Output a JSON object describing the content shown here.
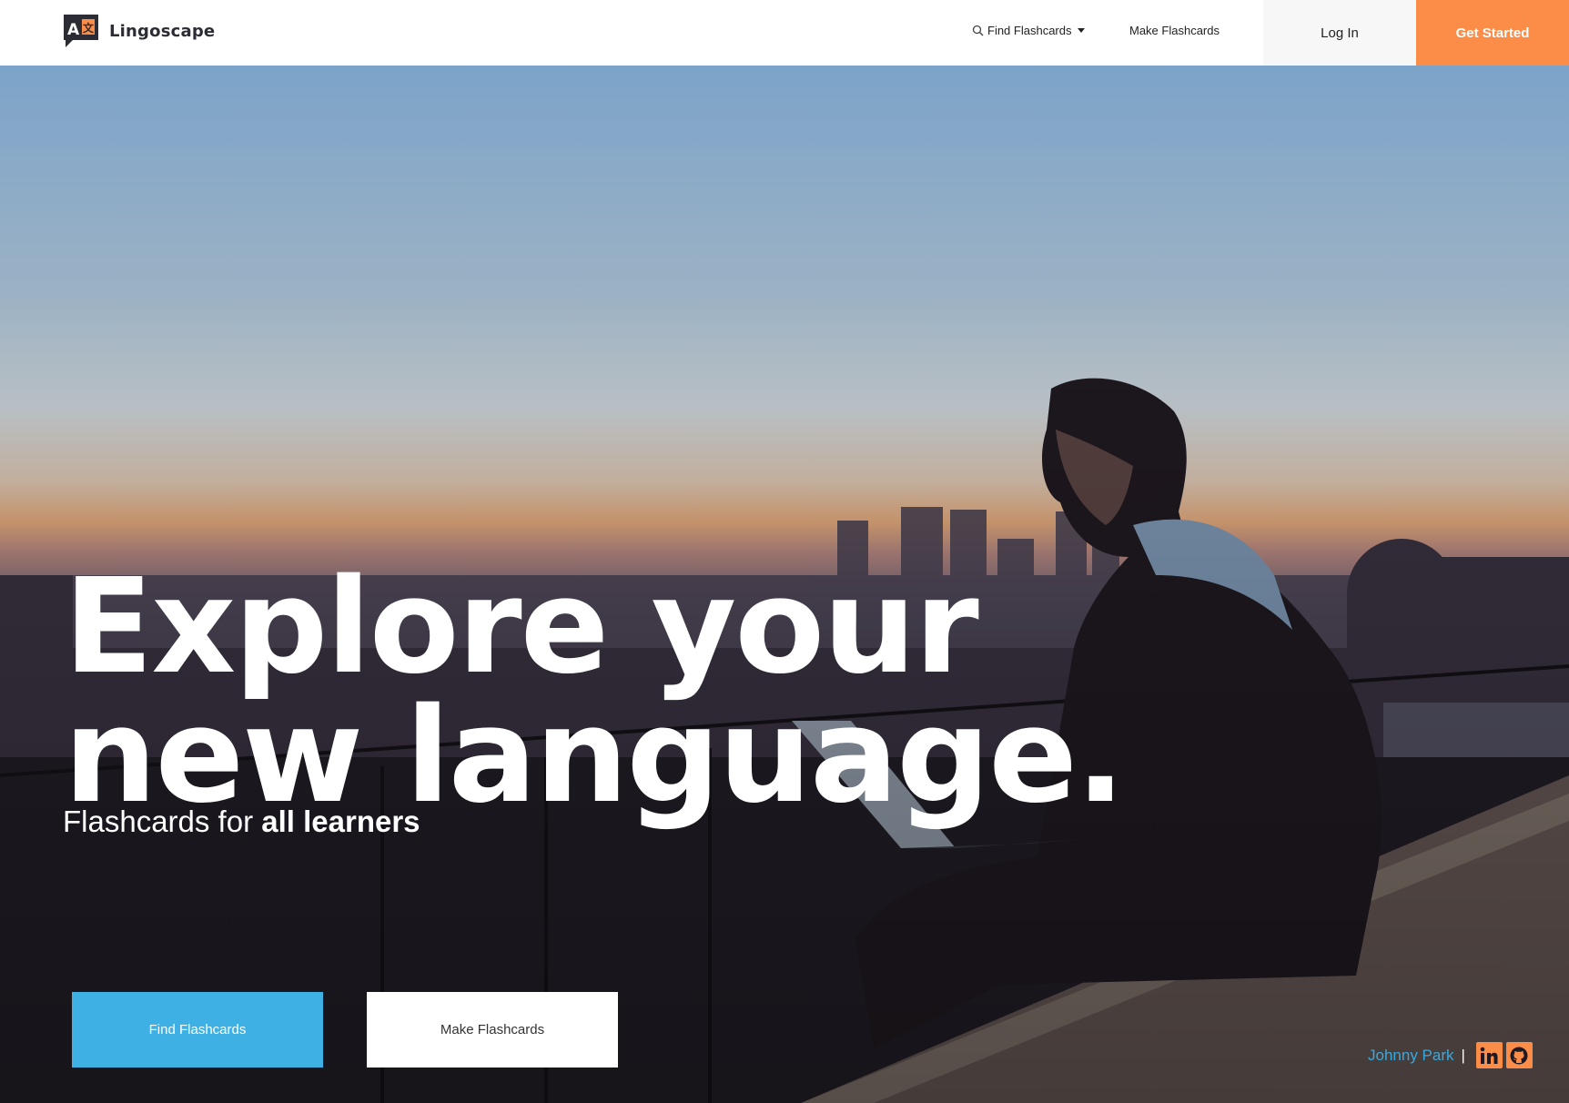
{
  "colors": {
    "accent_orange": "#fc8d48",
    "accent_blue": "#3fb0e4",
    "credit_link": "#3aa9de"
  },
  "nav": {
    "brand": "Lingoscape",
    "find_label": "Find Flashcards",
    "make_label": "Make Flashcards",
    "login_label": "Log In",
    "get_started_label": "Get Started",
    "icons": [
      "search-icon",
      "caret-down-icon"
    ]
  },
  "hero": {
    "title_line1": "Explore your",
    "title_line2": "new language.",
    "subtitle_plain": "Flashcards for ",
    "subtitle_bold": "all learners",
    "find_button": "Find Flashcards",
    "make_button": "Make Flashcards"
  },
  "footer": {
    "author": "Johnny Park",
    "separator": "|",
    "social_icons": [
      "linkedin-icon",
      "github-icon"
    ]
  }
}
